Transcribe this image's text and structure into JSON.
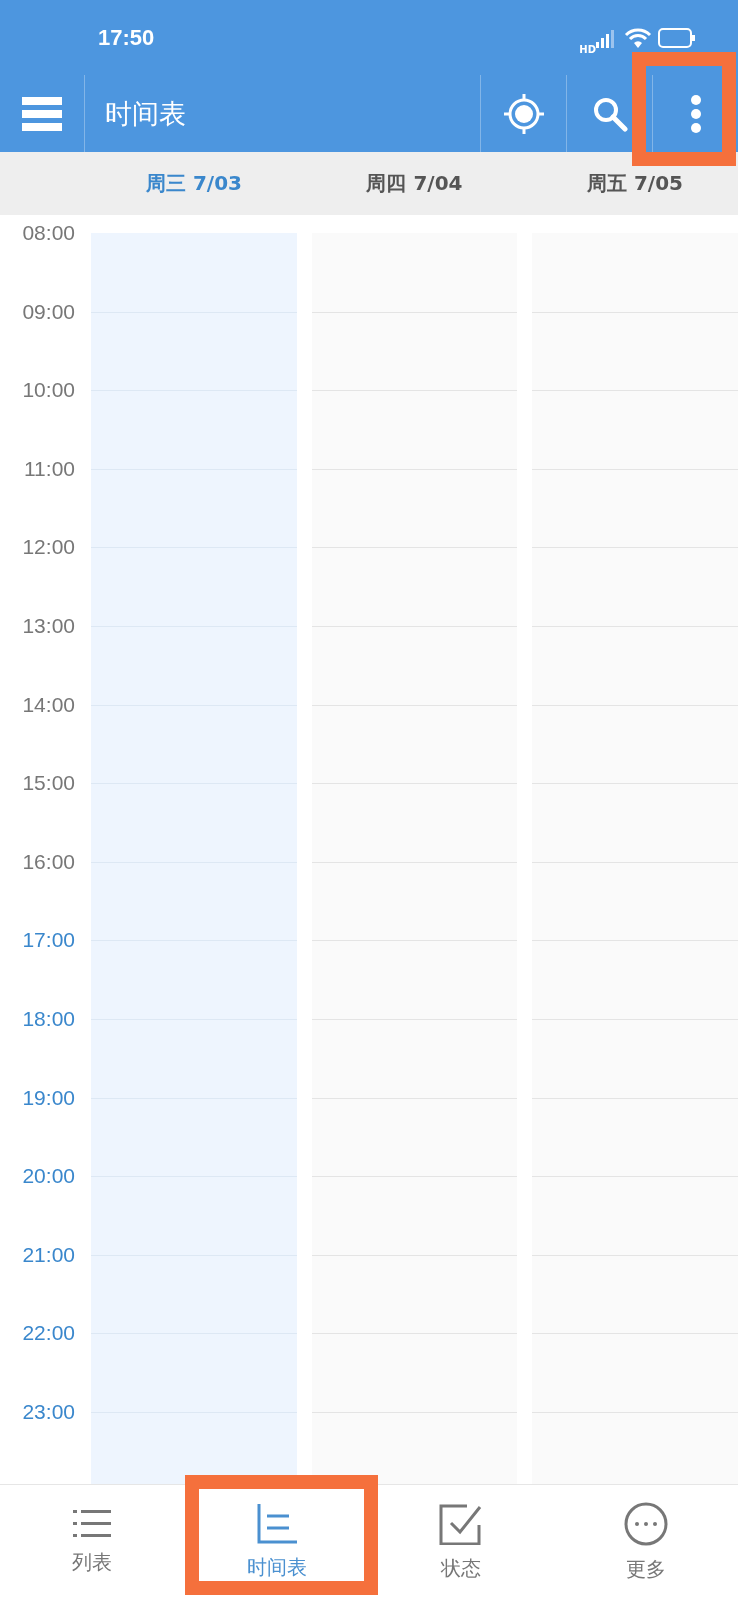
{
  "status_bar": {
    "time": "17:50",
    "network_label": "HD"
  },
  "toolbar": {
    "title": "时间表",
    "actions": [
      {
        "kind": "locate",
        "annotated": false
      },
      {
        "kind": "search",
        "annotated": false
      },
      {
        "kind": "more",
        "annotated": true
      }
    ]
  },
  "days": [
    {
      "label": "周三 7/03",
      "selected": true
    },
    {
      "label": "周四 7/04",
      "selected": false
    },
    {
      "label": "周五 7/05",
      "selected": false
    }
  ],
  "hours": [
    {
      "label": "08:00",
      "highlighted": false
    },
    {
      "label": "09:00",
      "highlighted": false
    },
    {
      "label": "10:00",
      "highlighted": false
    },
    {
      "label": "11:00",
      "highlighted": false
    },
    {
      "label": "12:00",
      "highlighted": false
    },
    {
      "label": "13:00",
      "highlighted": false
    },
    {
      "label": "14:00",
      "highlighted": false
    },
    {
      "label": "15:00",
      "highlighted": false
    },
    {
      "label": "16:00",
      "highlighted": false
    },
    {
      "label": "17:00",
      "highlighted": true
    },
    {
      "label": "18:00",
      "highlighted": true
    },
    {
      "label": "19:00",
      "highlighted": true
    },
    {
      "label": "20:00",
      "highlighted": true
    },
    {
      "label": "21:00",
      "highlighted": true
    },
    {
      "label": "22:00",
      "highlighted": true
    },
    {
      "label": "23:00",
      "highlighted": true
    }
  ],
  "bottom_nav": [
    {
      "kind": "list",
      "label": "列表",
      "selected": false,
      "annotated": false
    },
    {
      "kind": "timeline",
      "label": "时间表",
      "selected": true,
      "annotated": true
    },
    {
      "kind": "status",
      "label": "状态",
      "selected": false,
      "annotated": false
    },
    {
      "kind": "more",
      "label": "更多",
      "selected": false,
      "annotated": false
    }
  ]
}
